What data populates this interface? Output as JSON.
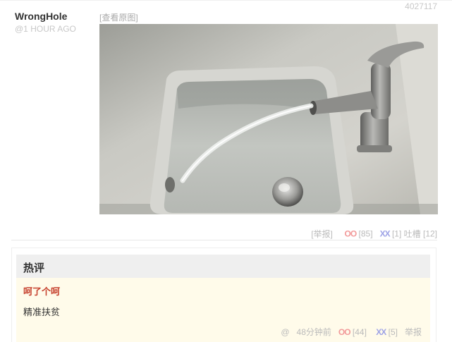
{
  "post": {
    "id": "4027117",
    "author": "WrongHole",
    "time_ago": "@1 HOUR AGO",
    "view_original": "[查看原图]"
  },
  "photo": {
    "subject": "water-faucet-pouring-into-sink",
    "colors": {
      "counter": "#c7c6c0",
      "basin": "#b9bcb7",
      "water": "#e8ece8",
      "metal": "#8c8c8a"
    }
  },
  "actions": {
    "report": "[举报]",
    "oo_icon": "OO",
    "oo_count": "[85]",
    "xx_icon": "XX",
    "xx_count": "[1]",
    "comment_label": "吐槽",
    "comment_count": "[12]"
  },
  "hot_comments": {
    "title": "热评",
    "item": {
      "author": "呵了个呵",
      "text": "精准扶贫",
      "at": "@",
      "time": "48分钟前",
      "oo_icon": "OO",
      "oo_count": "[44]",
      "xx_icon": "XX",
      "xx_count": "[5]",
      "report": "举报"
    }
  },
  "colors": {
    "oo": "#f29a9a",
    "xx": "#9ea3e6",
    "hot_author": "#c6402d",
    "hot_background": "#fffbea"
  }
}
